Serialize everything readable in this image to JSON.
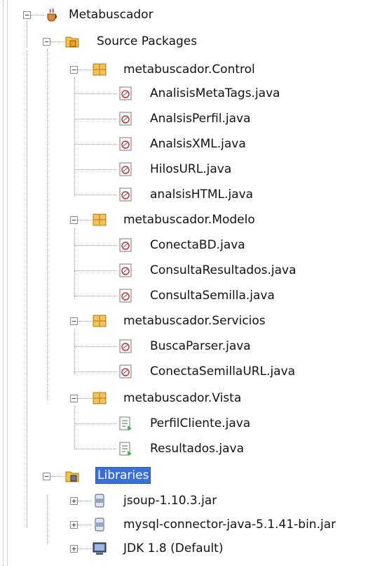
{
  "tree": {
    "project": "Metabuscador",
    "source_packages": "Source Packages",
    "packages": [
      {
        "name": "metabuscador.Control",
        "files": [
          "AnalisisMetaTags.java",
          "AnalsisPerfil.java",
          "AnalsisXML.java",
          "HilosURL.java",
          "analsisHTML.java"
        ]
      },
      {
        "name": "metabuscador.Modelo",
        "files": [
          "ConectaBD.java",
          "ConsultaResultados.java",
          "ConsultaSemilla.java"
        ]
      },
      {
        "name": "metabuscador.Servicios",
        "files": [
          "BuscaParser.java",
          "ConectaSemillaURL.java"
        ]
      },
      {
        "name": "metabuscador.Vista",
        "files": [
          "PerfilCliente.java",
          "Resultados.java"
        ]
      }
    ],
    "libraries": "Libraries",
    "library_items": [
      "jsoup-1.10.3.jar",
      "mysql-connector-java-5.1.41-bin.jar",
      "JDK 1.8 (Default)"
    ]
  },
  "icons": {
    "project": "coffee-cup-icon",
    "source_packages": "source-folder-icon",
    "package": "package-icon",
    "java_file": "java-class-icon",
    "form_file": "form-icon",
    "libraries": "library-folder-icon",
    "jar": "jar-icon",
    "jdk": "jdk-icon"
  },
  "colors": {
    "selection": "#3a6fd6",
    "package": "#e8a72c"
  }
}
